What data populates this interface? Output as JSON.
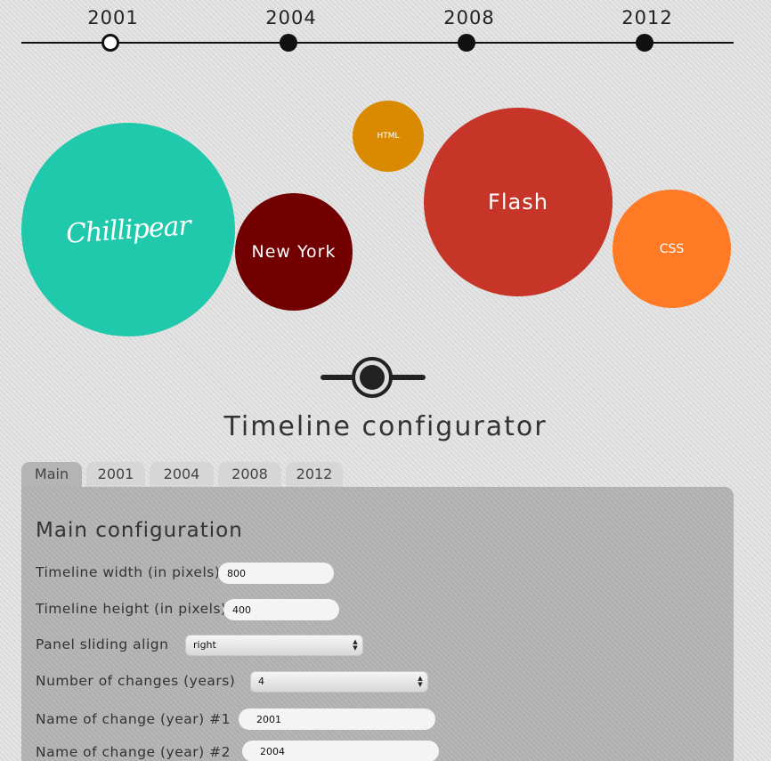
{
  "timeline": {
    "years": [
      "2001",
      "2004",
      "2008",
      "2012"
    ],
    "active_year": "2001"
  },
  "bubbles": {
    "chillipear_logo": "Chillipear",
    "new_york": "New York",
    "html": "HTML",
    "flash": "Flash",
    "css": "CSS",
    "colors": {
      "chillipear": "#20c9ab",
      "new_york": "#730000",
      "html": "#da8a00",
      "flash": "#c73528",
      "css": "#ff7a25"
    }
  },
  "configurator": {
    "title": "Timeline configurator",
    "tabs": [
      "Main",
      "2001",
      "2004",
      "2008",
      "2012"
    ],
    "active_tab": "Main",
    "panel_title": "Main configuration",
    "fields": {
      "width_label": "Timeline width (in pixels)",
      "width_value": "800",
      "height_label": "Timeline height (in pixels)",
      "height_value": "400",
      "align_label": "Panel sliding align",
      "align_value": "right",
      "changes_label": "Number of changes (years)",
      "changes_value": "4",
      "change1_label": "Name of change (year) #1",
      "change1_value": "2001",
      "change2_label": "Name of change (year) #2",
      "change2_value": "2004"
    }
  }
}
